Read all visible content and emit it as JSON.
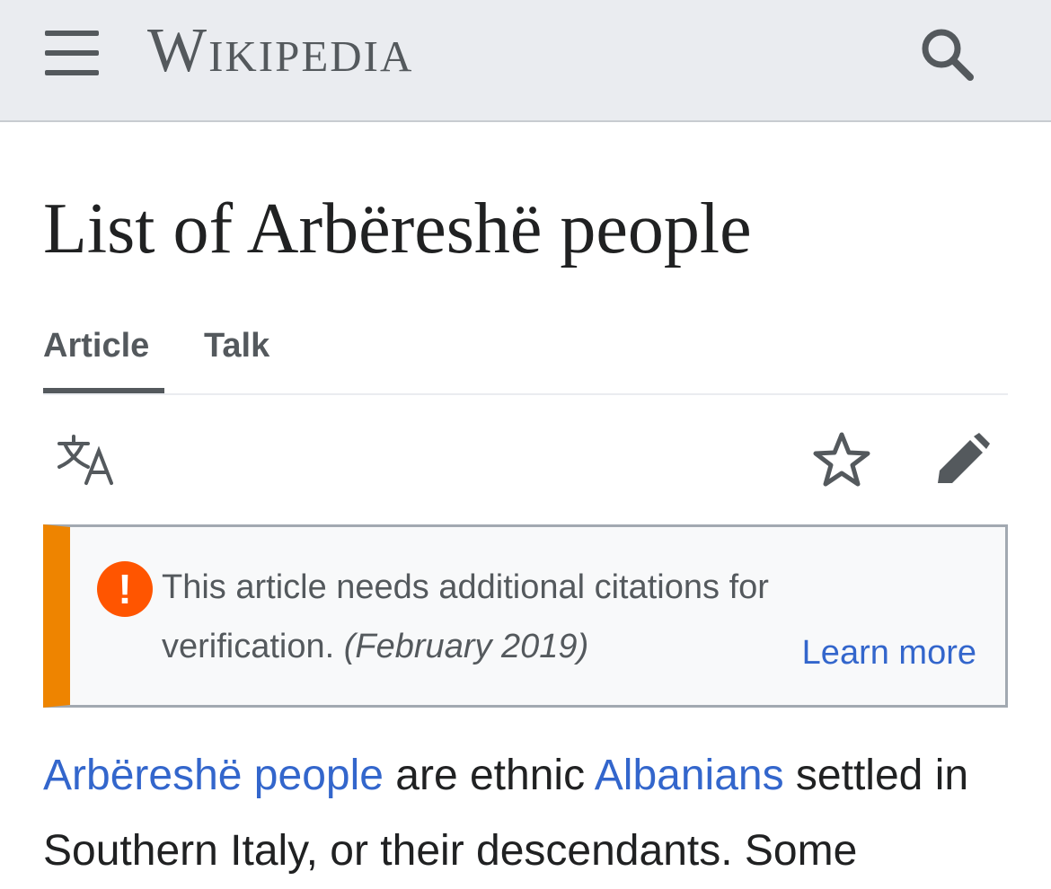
{
  "header": {
    "wordmark": "Wikipedia"
  },
  "page": {
    "title": "List of Arbëreshë people"
  },
  "tabs": {
    "article": "Article",
    "talk": "Talk"
  },
  "icons": {
    "menu": "menu-icon",
    "search": "search-icon",
    "language": "language-icon",
    "watch": "star-icon",
    "edit": "pencil-icon",
    "notice": "exclamation-icon"
  },
  "notice": {
    "line1": "This article needs additional citations for",
    "line2": "verification.",
    "date": "(February 2019)",
    "learn_more": "Learn more",
    "exclamation": "!"
  },
  "intro": {
    "link1": "Arbëreshë people",
    "text1": " are ethnic ",
    "link2": "Albanians",
    "text2": " settled in Southern Italy, or their descendants. Some"
  },
  "colors": {
    "topbar": "#eaecf0",
    "notice_accent": "#ee8400",
    "notice_icon": "#ff5500",
    "link": "#3366cc"
  }
}
